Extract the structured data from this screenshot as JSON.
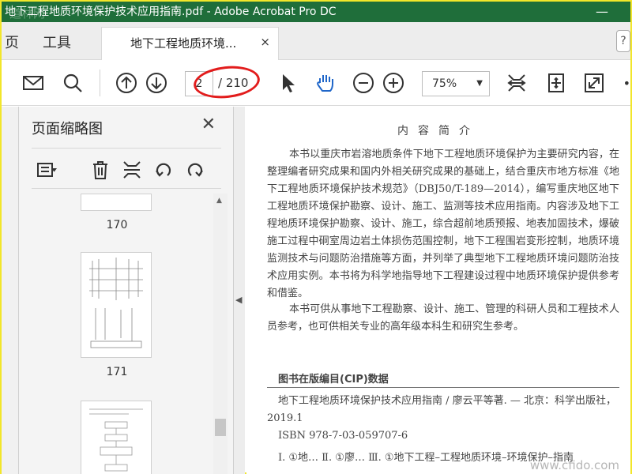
{
  "window": {
    "title": "地下工程地质环境保护技术应用指南.pdf - Adobe Acrobat Pro DC",
    "watermark_top": "道林网",
    "minimize_glyph": "—"
  },
  "tabs": {
    "home": "页",
    "tools": "工具",
    "document": "地下工程地质环境...",
    "close_glyph": "×",
    "help_glyph": "?"
  },
  "toolbar": {
    "icons": [
      "mail-icon",
      "search-icon",
      "prev-page-icon",
      "next-page-icon",
      "select-arrow-icon",
      "hand-icon",
      "zoom-out-icon",
      "zoom-in-icon",
      "fit-page-icon",
      "rotate-view-icon",
      "fullscreen-icon"
    ],
    "page_current": "2",
    "page_total": "/ 210",
    "zoom": "75%",
    "more_glyph": "•"
  },
  "sidebar": {
    "title": "页面缩略图",
    "close_glyph": "✕",
    "tools": [
      "thumbnail-options-icon",
      "delete-page-icon",
      "insert-page-icon",
      "rotate-left-icon",
      "rotate-right-icon"
    ],
    "thumbnails": [
      {
        "number": "170"
      },
      {
        "number": "171"
      },
      {
        "number": ""
      }
    ]
  },
  "document": {
    "heading": "内容简介",
    "para1": "本书以重庆市岩溶地质条件下地下工程地质环境保护为主要研究内容，在整理编者研究成果和国内外相关研究成果的基础上，结合重庆市地方标准《地下工程地质环境保护技术规范》（DBJ50/T-189—2014），编写重庆地区地下工程地质环境保护勘察、设计、施工、监测等技术应用指南。内容涉及地下工程地质环境保护勘察、设计、施工，综合超前地质预报、地表加固技术，爆破施工过程中硐室周边岩土体损伤范围控制，地下工程围岩变形控制，地质环境监测技术与问题防治措施等方面，并列举了典型地下工程地质环境问题防治技术应用实例。本书将为科学地指导地下工程建设过程中地质环境保护提供参考和借鉴。",
    "para2": "本书可供从事地下工程勘察、设计、施工、管理的科研人员和工程技术人员参考，也可供相关专业的高年级本科生和研究生参考。",
    "cip_title": "图书在版编目(CIP)数据",
    "cip_line1": "地下工程地质环境保护技术应用指南 / 廖云平等著. — 北京：科学出版社，",
    "cip_line1b": "2019.1",
    "cip_line2": "ISBN 978-7-03-059707-6",
    "cip_line3": "Ⅰ. ①地…  Ⅱ. ①廖…  Ⅲ. ①地下工程–工程地质环境–环境保护–指南",
    "watermark": "www.cfido.com"
  },
  "colors": {
    "titlebar": "#1f6e3a",
    "accent_blue": "#1f66c9",
    "annotation_red": "#e21c1c"
  }
}
